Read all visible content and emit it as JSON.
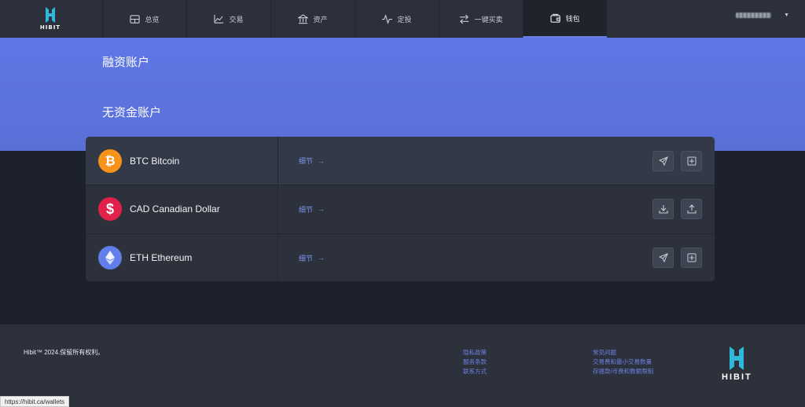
{
  "nav": {
    "logo_text": "HIBIT",
    "items": [
      {
        "label": "总览",
        "icon": "dashboard-icon"
      },
      {
        "label": "交易",
        "icon": "chart-line-icon"
      },
      {
        "label": "资产",
        "icon": "bank-icon"
      },
      {
        "label": "定投",
        "icon": "pulse-icon"
      },
      {
        "label": "一键买卖",
        "icon": "swap-icon"
      },
      {
        "label": "钱包",
        "icon": "wallet-icon",
        "active": true
      }
    ]
  },
  "hero": {
    "financing_title": "融资账户",
    "no_funds_title": "无资金账户"
  },
  "accounts": [
    {
      "name": "BTC Bitcoin",
      "detail": "细节",
      "icon": "bitcoin-icon",
      "color": "#f7931a",
      "actions": [
        "send-icon",
        "deposit-qr-icon"
      ]
    },
    {
      "name": "CAD Canadian Dollar",
      "detail": "细节",
      "icon": "dollar-icon",
      "color": "#e2214b",
      "actions": [
        "download-icon",
        "upload-icon"
      ]
    },
    {
      "name": "ETH Ethereum",
      "detail": "细节",
      "icon": "ethereum-icon",
      "color": "#627eea",
      "actions": [
        "send-icon",
        "deposit-qr-icon"
      ]
    }
  ],
  "footer": {
    "copyright": "Hibit™ 2024.保留所有权利。",
    "links_col1": [
      "隐私政策",
      "服务条款",
      "联系方式"
    ],
    "links_col2": [
      "常见问题",
      "交易费和最小交易数量",
      "存提款/币费和数额限制"
    ],
    "logo_text": "HIBIT"
  },
  "status_url": "https://hibit.ca/wallets",
  "colors": {
    "accent": "#6a80e6",
    "hero": "#5f78e6",
    "bg": "#1d212b",
    "panel": "#2b303b"
  }
}
